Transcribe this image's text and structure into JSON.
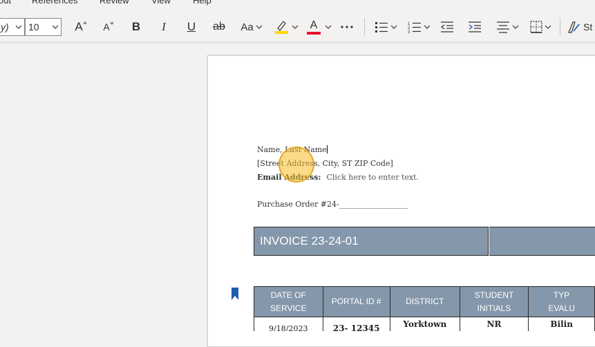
{
  "menu": {
    "tabs": [
      "out",
      "References",
      "Review",
      "View",
      "Help"
    ]
  },
  "ribbon": {
    "font_name_value": "y)",
    "font_size_value": "10",
    "grow_font_label": "A",
    "shrink_font_label": "A",
    "bold_label": "B",
    "italic_label": "I",
    "underline_label": "U",
    "strikethrough_label": "ab",
    "change_case_label": "Aa",
    "font_color_label": "A",
    "styles_label": "St"
  },
  "colors": {
    "highlight": "#ffd800",
    "font_color": "#e8112d",
    "header_fill": "#8497ab",
    "bookmark": "#1e5cb3",
    "click_indicator": "#f7be28"
  },
  "document": {
    "name_line": "Name, Last Name",
    "address_line": "[Street Address, City, ST ZIP Code]",
    "email_label": "Email Address:",
    "email_placeholder": "Click here to enter text.",
    "po_line": "Purchase Order #24-__________________",
    "invoice_title": "INVOICE 23-24-01",
    "table": {
      "headers": [
        "DATE OF SERVICE",
        "PORTAL ID #",
        "DISTRICT",
        "STUDENT INITIALS",
        "TYPE OF EVALUATION"
      ],
      "header_display": [
        "DATE OF\nSERVICE",
        "PORTAL ID #",
        "DISTRICT",
        "STUDENT\nINITIALS",
        "TYP\nEVALU"
      ],
      "rows": [
        [
          "9/18/2023",
          "23- 12345",
          "Yorktown",
          "NR",
          "Bilin"
        ]
      ]
    }
  }
}
